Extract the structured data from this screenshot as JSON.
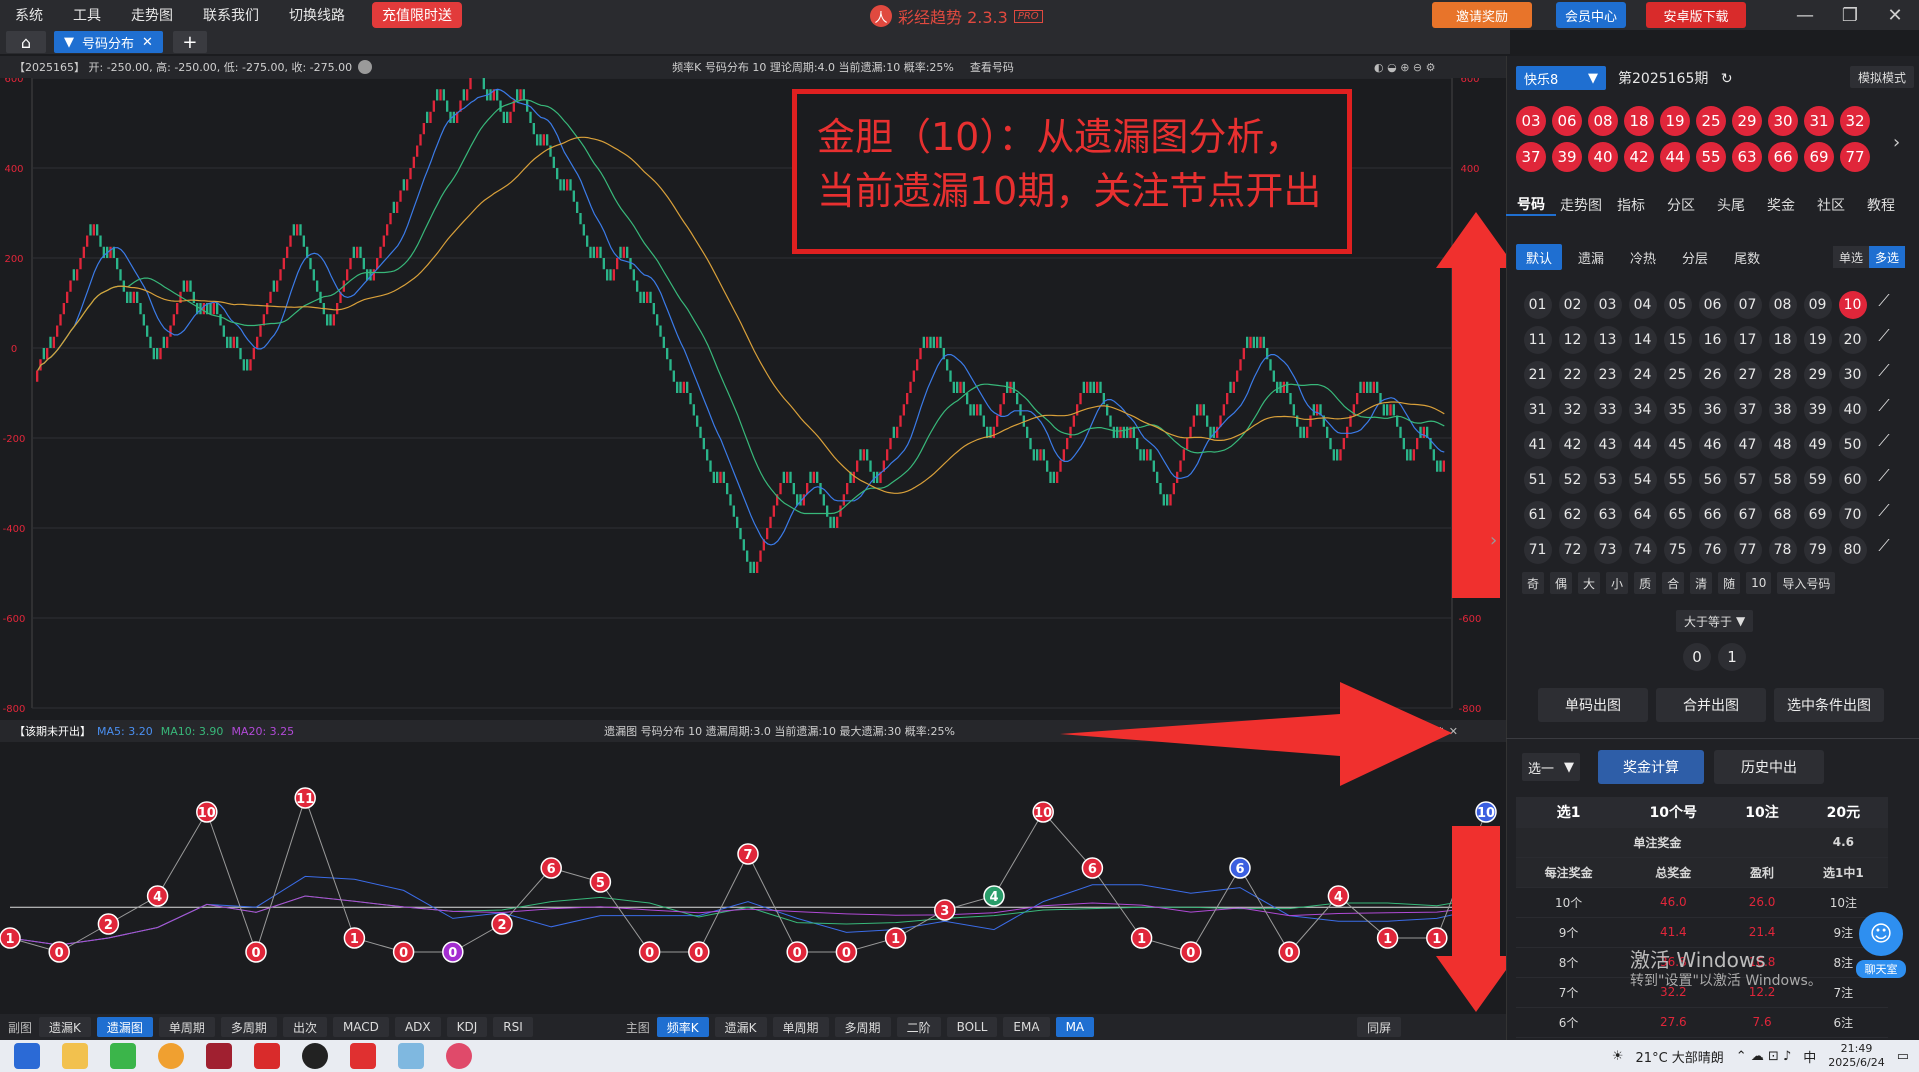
{
  "menu": [
    "系统",
    "工具",
    "走势图",
    "联系我们",
    "切换线路"
  ],
  "promo": "充值限时送",
  "app_title": "彩经趋势 2.3.3",
  "app_badge": "PRO",
  "header_buttons": {
    "invite": "邀请奖励",
    "member": "会员中心",
    "android": "安卓版下载"
  },
  "tab": {
    "label": "号码分布"
  },
  "infobar": {
    "left": "【2025165】 开: -250.00, 高: -250.00, 低: -275.00, 收: -275.00",
    "middle": "频率K  号码分布  10     理论周期:4.0  当前遗漏:10  概率:25%",
    "view": "查看号码"
  },
  "subinfo": {
    "left_prefix": "【该期未开出】",
    "ma5": "MA5: 3.20",
    "ma10": "MA10: 3.90",
    "ma20": "MA20: 3.25",
    "middle": "遗漏图  号码分布  10     遗漏周期:3.0  当前遗漏:10  最大遗漏:30  概率:25%"
  },
  "annotation": {
    "line1": "金胆（10）：从遗漏图分析，",
    "line2": "当前遗漏10期，关注节点开出"
  },
  "chart_data": {
    "type": "candlestick",
    "y_ticks": [
      "600",
      "400",
      "200",
      "0",
      "-200",
      "-400",
      "-600",
      "-800"
    ],
    "ylim": [
      -800,
      600
    ],
    "ma_lines": [
      "MA5",
      "MA10",
      "MA20"
    ],
    "close_series": [
      -50,
      -25,
      0,
      150,
      250,
      200,
      100,
      -25,
      0,
      125,
      75,
      75,
      0,
      -50,
      125,
      250,
      50,
      200,
      150,
      300,
      350,
      500,
      550,
      500,
      550,
      600,
      550,
      500,
      550,
      450,
      350,
      200,
      150,
      200,
      100,
      -100,
      -300,
      -500,
      -300,
      -350,
      -300,
      -400,
      -300,
      -250,
      -300,
      -200,
      0,
      0,
      -100,
      -150,
      -200,
      -100,
      -250,
      -300,
      -100,
      -100,
      -200,
      -200,
      -250,
      -350,
      -150,
      -200,
      -100,
      0,
      0,
      -100,
      -200,
      -150,
      -250,
      -100,
      -100,
      -150,
      -250,
      -200,
      -275
    ]
  },
  "omission_data": {
    "type": "line",
    "values": [
      1,
      0,
      2,
      4,
      10,
      0,
      11,
      1,
      0,
      0,
      2,
      6,
      5,
      0,
      0,
      7,
      0,
      0,
      1,
      3,
      4,
      10,
      6,
      1,
      0,
      6,
      0,
      4,
      1,
      1,
      10
    ],
    "special": {
      "purple": [
        9
      ],
      "green": [
        20
      ],
      "blue": [
        25,
        30
      ]
    }
  },
  "bottom_toolbar": {
    "sub_label": "副图",
    "sub_items": [
      "遗漏K",
      "遗漏图",
      "单周期",
      "多周期",
      "出次",
      "MACD",
      "ADX",
      "KDJ",
      "RSI"
    ],
    "main_label": "主图",
    "main_items": [
      "频率K",
      "遗漏K",
      "单周期",
      "多周期",
      "二阶",
      "BOLL",
      "EMA",
      "MA"
    ],
    "sync": "同屏"
  },
  "right": {
    "lottery": "快乐8",
    "period": "第2025165期",
    "sim": "模拟模式",
    "draw_numbers": [
      "03",
      "06",
      "08",
      "18",
      "19",
      "25",
      "29",
      "30",
      "31",
      "32",
      "37",
      "39",
      "40",
      "42",
      "44",
      "55",
      "63",
      "66",
      "69",
      "77"
    ],
    "nav_tabs": [
      "号码",
      "走势图",
      "指标",
      "分区",
      "头尾",
      "奖金",
      "社区",
      "教程"
    ],
    "sub_tabs": [
      "默认",
      "遗漏",
      "冷热",
      "分层",
      "尾数"
    ],
    "select_single": "单选",
    "select_multi": "多选",
    "numbers": [
      "01",
      "02",
      "03",
      "04",
      "05",
      "06",
      "07",
      "08",
      "09",
      "10",
      "11",
      "12",
      "13",
      "14",
      "15",
      "16",
      "17",
      "18",
      "19",
      "20",
      "21",
      "22",
      "23",
      "24",
      "25",
      "26",
      "27",
      "28",
      "29",
      "30",
      "31",
      "32",
      "33",
      "34",
      "35",
      "36",
      "37",
      "38",
      "39",
      "40",
      "41",
      "42",
      "43",
      "44",
      "45",
      "46",
      "47",
      "48",
      "49",
      "50",
      "51",
      "52",
      "53",
      "54",
      "55",
      "56",
      "57",
      "58",
      "59",
      "60",
      "61",
      "62",
      "63",
      "64",
      "65",
      "66",
      "67",
      "68",
      "69",
      "70",
      "71",
      "72",
      "73",
      "74",
      "75",
      "76",
      "77",
      "78",
      "79",
      "80"
    ],
    "selected": "10",
    "quick_filters": [
      "奇",
      "偶",
      "大",
      "小",
      "质",
      "合",
      "清",
      "随",
      "10",
      "导入号码"
    ],
    "ge": "大于等于",
    "counts": [
      "0",
      "1"
    ],
    "actions": [
      "单码出图",
      "合并出图",
      "选中条件出图"
    ],
    "pick": "选一",
    "calc": "奖金计算",
    "history": "历史中出",
    "prize_header": [
      "选1",
      "10个号",
      "10注",
      "20元"
    ],
    "single_prize_label": "单注奖金",
    "single_prize_value": "4.6",
    "prize_cols": [
      "每注奖金",
      "总奖金",
      "盈利",
      "选1中1"
    ],
    "prize_rows": [
      [
        "10个",
        "46.0",
        "26.0",
        "10注"
      ],
      [
        "9个",
        "41.4",
        "21.4",
        "9注"
      ],
      [
        "8个",
        "36.8",
        "16.8",
        "8注"
      ],
      [
        "7个",
        "32.2",
        "12.2",
        "7注"
      ],
      [
        "6个",
        "27.6",
        "7.6",
        "6注"
      ]
    ],
    "chat": "聊天室"
  },
  "watermark": {
    "line1": "激活 Windows",
    "line2": "转到\"设置\"以激活 Windows。"
  },
  "taskbar": {
    "weather": "21°C 大部晴朗",
    "ime": "中",
    "time": "21:49",
    "date": "2025/6/24"
  }
}
